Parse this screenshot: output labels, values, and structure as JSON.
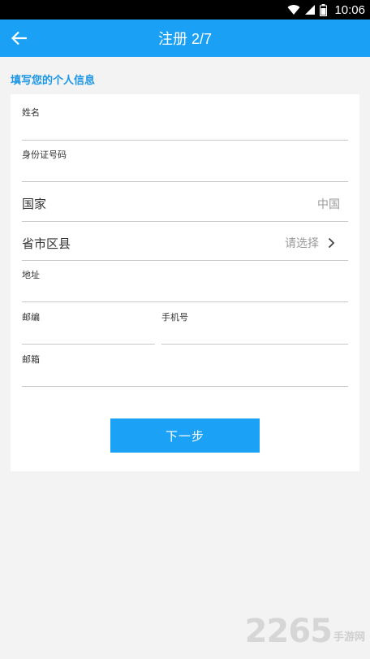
{
  "status_bar": {
    "time": "10:06",
    "icons": [
      "wifi-icon",
      "signal-icon",
      "battery-icon"
    ]
  },
  "app_bar": {
    "title": "注册 2/7",
    "back_icon": "arrow-left-icon",
    "color": "#1aa1f5"
  },
  "section": {
    "heading": "填写您的个人信息"
  },
  "form": {
    "name_label": "姓名",
    "id_label": "身份证号码",
    "country_label": "国家",
    "country_value": "中国",
    "region_label": "省市区县",
    "region_value": "请选择",
    "address_label": "地址",
    "postcode_label": "邮编",
    "phone_label": "手机号",
    "email_label": "邮箱"
  },
  "next_button": {
    "label": "下一步",
    "color": "#1ba1f5"
  },
  "watermark": {
    "number": "2265",
    "text": "手游网"
  }
}
